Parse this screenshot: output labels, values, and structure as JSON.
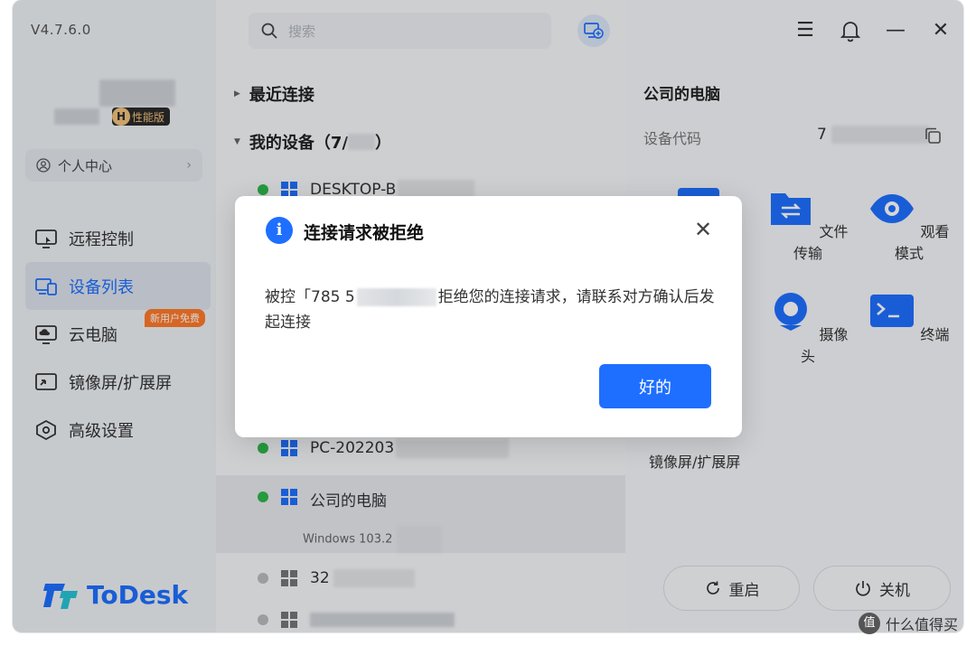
{
  "app": {
    "version": "V4.7.6.0",
    "brand": "ToDesk"
  },
  "colors": {
    "accent": "#1e6fff",
    "online": "#2eb84a",
    "offline": "#bcbcbc",
    "promo": "#ff7a2a"
  },
  "user": {
    "tier_badge_letter": "H",
    "tier_badge_text": "性能版"
  },
  "sidebar": {
    "personal_center": "个人中心",
    "items": [
      {
        "label": "远程控制",
        "icon": "monitor-remote-icon"
      },
      {
        "label": "设备列表",
        "icon": "device-list-icon",
        "active": true
      },
      {
        "label": "云电脑",
        "icon": "cloud-pc-icon",
        "badge": "新用户免费"
      },
      {
        "label": "镜像屏/扩展屏",
        "icon": "mirror-screen-icon"
      },
      {
        "label": "高级设置",
        "icon": "settings-icon"
      }
    ]
  },
  "search": {
    "placeholder": "搜索"
  },
  "device_list": {
    "recent_group": "最近连接",
    "my_devices_group": "我的设备（7/",
    "my_devices_group_end": "）",
    "devices": [
      {
        "name": "DESKTOP-B",
        "status": "online"
      },
      {
        "name": "PC-202203",
        "status": "online"
      },
      {
        "name": "公司的电脑",
        "status": "online",
        "detail": "Windows  103.2",
        "selected": true
      },
      {
        "name": "32",
        "status": "offline"
      }
    ]
  },
  "detail_panel": {
    "title": "公司的电脑",
    "code_label": "设备代码",
    "code_value_prefix": "7",
    "tools": [
      "文件传输",
      "观看模式",
      "摄像头",
      "终端",
      "镜像屏/扩展屏"
    ],
    "restart": "重启",
    "shutdown": "关机"
  },
  "dialog": {
    "title": "连接请求被拒绝",
    "message_prefix": "被控「785 5",
    "message_suffix": "拒绝您的连接请求，请联系对方确认后发起连接",
    "ok": "好的"
  },
  "watermark": {
    "text": "什么值得买",
    "icon_char": "值"
  }
}
